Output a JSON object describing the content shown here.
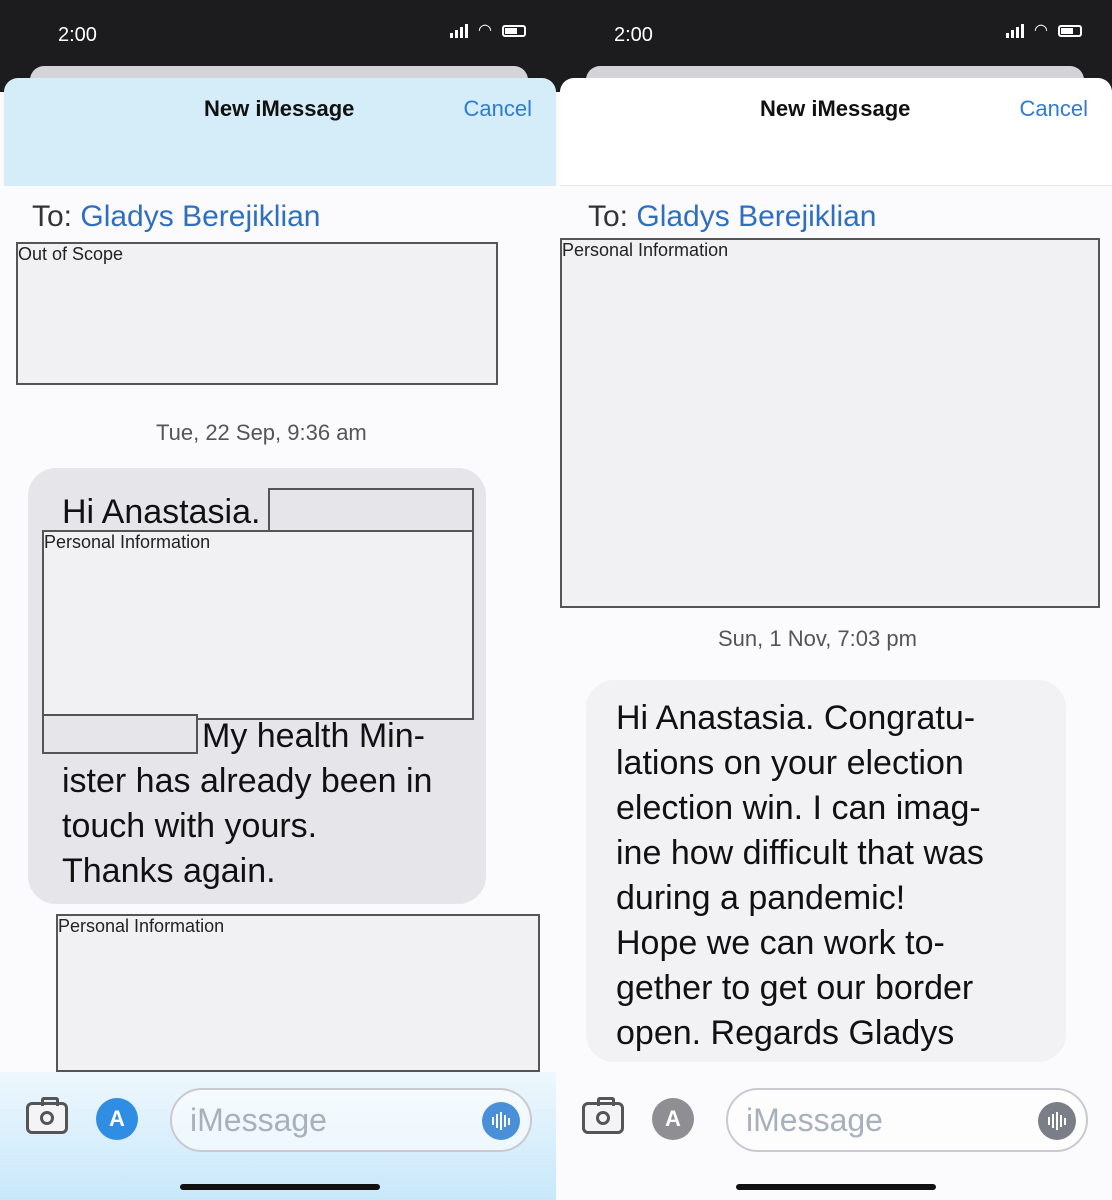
{
  "left": {
    "status_time": "2:00",
    "nav_title": "New iMessage",
    "cancel_label": "Cancel",
    "to_label": "To:",
    "recipient": "Gladys Berejiklian",
    "redaction_top_label": "Out of Scope",
    "timestamp": "Tue, 22 Sep, 9:36 am",
    "message_lines": [
      "Hi Anastasia."
    ],
    "redaction_mid_label": "Personal Information",
    "message_lines_2": [
      "My health Min-",
      "ister has already been in",
      "touch with yours.",
      "Thanks again."
    ],
    "redaction_bottom_label": "Personal Information",
    "input_placeholder": "iMessage"
  },
  "right": {
    "status_time": "2:00",
    "nav_title": "New iMessage",
    "cancel_label": "Cancel",
    "to_label": "To:",
    "recipient": "Gladys Berejiklian",
    "redaction_top_label": "Personal Information",
    "timestamp": "Sun, 1 Nov, 7:03 pm",
    "message_lines": [
      "Hi Anastasia.  Congratu-",
      "lations on your election",
      "election win.  I can imag-",
      "ine how difficult that was",
      "during a pandemic!",
      "Hope we can work to-",
      "gether to get our border",
      "open.  Regards Gladys"
    ],
    "input_placeholder": "iMessage"
  },
  "icons": [
    "signal-icon",
    "wifi-icon",
    "battery-icon",
    "camera-icon",
    "app-store-icon",
    "audio-icon"
  ],
  "colors": {
    "link": "#2f7bd1",
    "bubble": "#e5e5ea",
    "statusbar": "#1c1c1e"
  }
}
